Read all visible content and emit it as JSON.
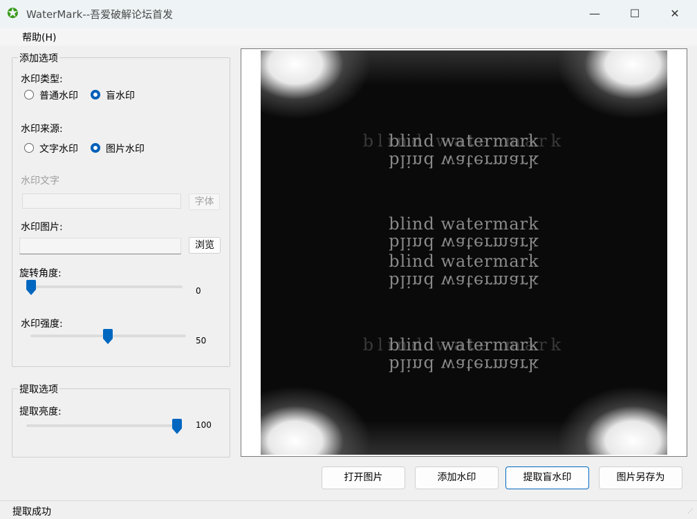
{
  "window": {
    "title": "WaterMark--吾爱破解论坛首发",
    "icon": "green-star-icon",
    "minimize_glyph": "—",
    "maximize_glyph": "☐",
    "close_glyph": "✕"
  },
  "menu": {
    "items": [
      {
        "label": "帮助(H)"
      }
    ]
  },
  "add_options": {
    "title": "添加选项",
    "type_label": "水印类型:",
    "type_options": [
      {
        "label": "普通水印",
        "checked": false
      },
      {
        "label": "盲水印",
        "checked": true
      }
    ],
    "source_label": "水印来源:",
    "source_options": [
      {
        "label": "文字水印",
        "checked": false
      },
      {
        "label": "图片水印",
        "checked": true
      }
    ],
    "text_label": "水印文字",
    "text_value": "",
    "font_button": "字体",
    "image_label": "水印图片:",
    "image_value": "",
    "browse_button": "浏览",
    "rotation_label": "旋转角度:",
    "rotation_value": "0",
    "rotation_fraction": 0.0,
    "strength_label": "水印强度:",
    "strength_value": "50",
    "strength_fraction": 0.5
  },
  "extract_options": {
    "title": "提取选项",
    "brightness_label": "提取亮度:",
    "brightness_value": "100",
    "brightness_fraction": 1.0
  },
  "preview": {
    "watermark_text": "blind watermark"
  },
  "buttons": {
    "open": "打开图片",
    "add": "添加水印",
    "extract": "提取盲水印",
    "save_as": "图片另存为"
  },
  "status": {
    "text": "提取成功"
  },
  "colors": {
    "accent": "#0067c0",
    "app_icon": "#3a9a1a"
  }
}
